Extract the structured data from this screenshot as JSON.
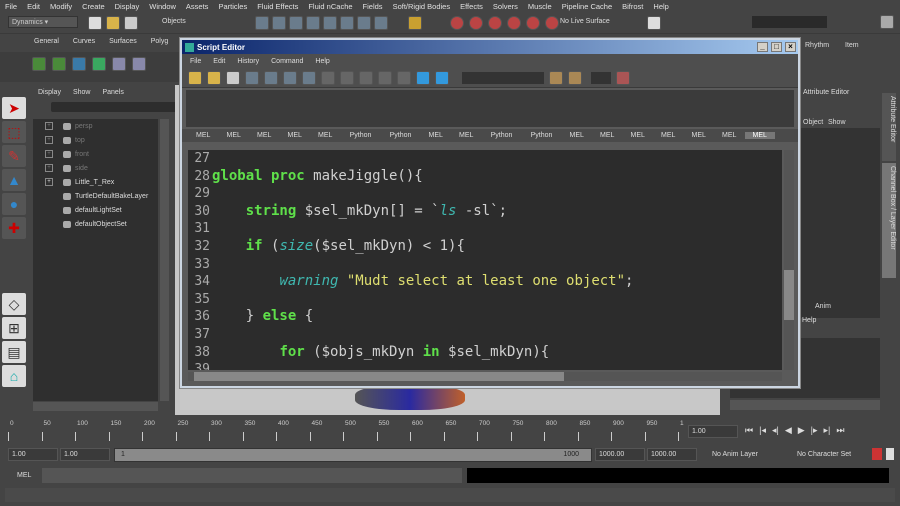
{
  "menubar": [
    "File",
    "Edit",
    "Modify",
    "Create",
    "Display",
    "Window",
    "Assets",
    "Particles",
    "Fluid Effects",
    "Fluid nCache",
    "Fields",
    "Soft/Rigid Bodies",
    "Effects",
    "Solvers",
    "Muscle",
    "Pipeline Cache",
    "Bifrost",
    "Help"
  ],
  "toolbar": {
    "mode": "Dynamics",
    "objects": "Objects",
    "live_surface": "No Live Surface"
  },
  "shelf_tabs": [
    "General",
    "Curves",
    "Surfaces",
    "Polyg"
  ],
  "right_top": {
    "tab1": "Rhythm",
    "tab2": "Item"
  },
  "outliner": {
    "menu": [
      "Display",
      "Show",
      "Panels"
    ],
    "items": [
      {
        "label": "persp",
        "dim": true
      },
      {
        "label": "top",
        "dim": true
      },
      {
        "label": "front",
        "dim": true
      },
      {
        "label": "side",
        "dim": true
      },
      {
        "label": "Little_T_Rex",
        "dim": false
      },
      {
        "label": "TurtleDefaultBakeLayer",
        "dim": false
      },
      {
        "label": "defaultLightSet",
        "dim": false
      },
      {
        "label": "defaultObjectSet",
        "dim": false
      }
    ]
  },
  "script_editor": {
    "title": "Script Editor",
    "menu": [
      "File",
      "Edit",
      "History",
      "Command",
      "Help"
    ],
    "tabs": [
      "MEL",
      "MEL",
      "MEL",
      "MEL",
      "MEL",
      "Python",
      "Python",
      "MEL",
      "MEL",
      "Python",
      "Python",
      "MEL",
      "MEL",
      "MEL",
      "MEL",
      "MEL",
      "MEL",
      "MEL"
    ],
    "active_tab": 17,
    "code": [
      {
        "n": "27",
        "t": []
      },
      {
        "n": "28",
        "t": [
          [
            "global proc",
            "kw"
          ],
          [
            " makeJiggle(){",
            "txt"
          ]
        ]
      },
      {
        "n": "29",
        "t": []
      },
      {
        "n": "30",
        "t": [
          [
            "    ",
            "txt"
          ],
          [
            "string",
            "kw"
          ],
          [
            " $sel_mkDyn[] = `",
            "txt"
          ],
          [
            "ls",
            "fn"
          ],
          [
            " -sl`;",
            "txt"
          ]
        ]
      },
      {
        "n": "31",
        "t": []
      },
      {
        "n": "32",
        "t": [
          [
            "    ",
            "txt"
          ],
          [
            "if",
            "kw"
          ],
          [
            " (",
            "txt"
          ],
          [
            "size",
            "fn"
          ],
          [
            "($sel_mkDyn) < 1){",
            "txt"
          ]
        ]
      },
      {
        "n": "33",
        "t": []
      },
      {
        "n": "34",
        "t": [
          [
            "        ",
            "txt"
          ],
          [
            "warning",
            "fn"
          ],
          [
            " \"Mudt select at least one object\"",
            "str"
          ],
          [
            ";",
            "txt"
          ]
        ]
      },
      {
        "n": "35",
        "t": []
      },
      {
        "n": "36",
        "t": [
          [
            "    } ",
            "txt"
          ],
          [
            "else",
            "kw"
          ],
          [
            " {",
            "txt"
          ]
        ]
      },
      {
        "n": "37",
        "t": []
      },
      {
        "n": "38",
        "t": [
          [
            "        ",
            "txt"
          ],
          [
            "for",
            "kw"
          ],
          [
            " ($objs_mkDyn ",
            "txt"
          ],
          [
            "in",
            "kw"
          ],
          [
            " $sel_mkDyn){",
            "txt"
          ]
        ]
      },
      {
        "n": "39",
        "t": []
      }
    ]
  },
  "attribute_panel": {
    "title": "Attribute Editor",
    "menu": [
      "Object",
      "Show"
    ],
    "side_tabs": [
      "Attribute Editor",
      "Channel Box / Layer Editor"
    ],
    "layer_tab": "Anim",
    "layer_menu": "Help"
  },
  "timeline": {
    "ticks": [
      "0",
      "50",
      "100",
      "150",
      "200",
      "250",
      "300",
      "350",
      "400",
      "450",
      "500",
      "550",
      "600",
      "650",
      "700",
      "750",
      "800",
      "850",
      "900",
      "950",
      "1"
    ],
    "current_frame": "1.00"
  },
  "range": {
    "start": "1.00",
    "playback_start": "1.00",
    "slider_start": "1",
    "slider_end": "1000",
    "playback_end": "1000.00",
    "end": "1000.00",
    "anim_layer": "No Anim Layer",
    "character_set": "No Character Set"
  },
  "command_line": {
    "label": "MEL"
  }
}
